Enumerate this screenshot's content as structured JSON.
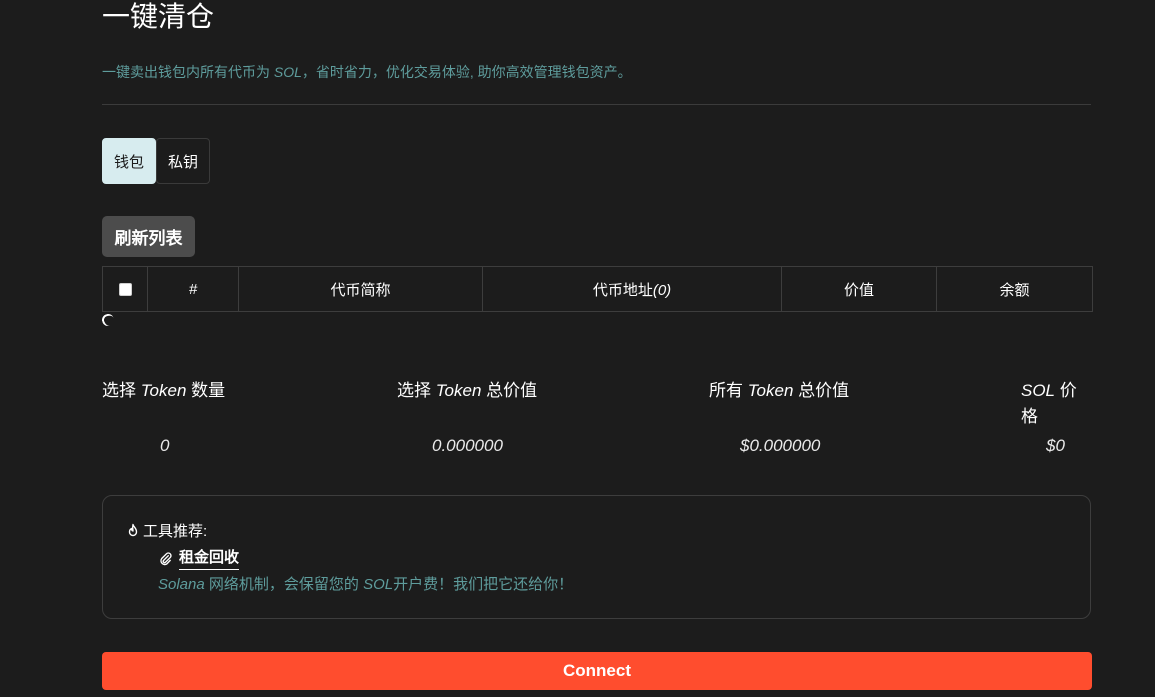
{
  "page": {
    "title": "一键清仓",
    "subtitle_pre": "一键卖出钱包内所有代币为 ",
    "subtitle_sol": "SOL",
    "subtitle_post": "，省时省力，优化交易体验, 助你高效管理钱包资产。"
  },
  "tabs": [
    {
      "label": "钱包",
      "active": true
    },
    {
      "label": "私钥",
      "active": false
    }
  ],
  "refresh_button": "刷新列表",
  "table": {
    "columns": {
      "index": "#",
      "name": "代币简称",
      "address": "代币地址",
      "address_count": "(0)",
      "value": "价值",
      "balance": "余额"
    },
    "rows": []
  },
  "stats": [
    {
      "label_pre": "选择 ",
      "label_token": "Token",
      "label_post": " 数量",
      "value": "0"
    },
    {
      "label_pre": "选择 ",
      "label_token": "Token",
      "label_post": " 总价值",
      "value": "0.000000"
    },
    {
      "label_pre": "所有 ",
      "label_token": "Token",
      "label_post": " 总价值",
      "value": "$0.000000"
    },
    {
      "label_pre": "",
      "label_token": "SOL",
      "label_post": " 价格",
      "value": "$0"
    }
  ],
  "recommend": {
    "heading": "工具推荐:",
    "link_label": "租金回收",
    "desc_solana": "Solana",
    "desc_mid": " 网络机制，会保留您的 ",
    "desc_sol": "SOL",
    "desc_post": "开户费！我们把它还给你！"
  },
  "connect_button": "Connect",
  "colors": {
    "background": "#1c1c1c",
    "accent_teal": "#5e9c9c",
    "connect_orange": "#ff4d2e",
    "active_tab": "#d7ecef"
  },
  "icons": [
    "fire-icon",
    "paperclip-icon",
    "loading-spinner-icon"
  ]
}
